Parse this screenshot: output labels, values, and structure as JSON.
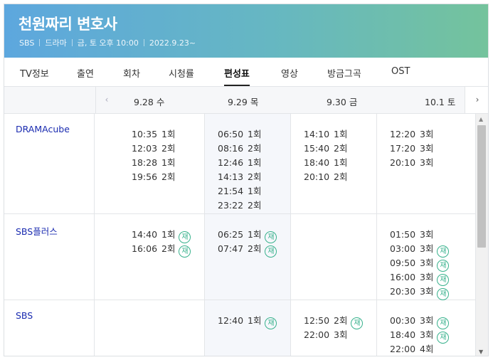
{
  "hero": {
    "title": "천원짜리 변호사",
    "network": "SBS",
    "genre": "드라마",
    "schedule": "금, 토 오후 10:00",
    "premiere": "2022.9.23~"
  },
  "tabs": [
    "TV정보",
    "출연",
    "회차",
    "시청률",
    "편성표",
    "영상",
    "방금그곡",
    "OST"
  ],
  "active_tab": "편성표",
  "datebar": {
    "prev_icon": "‹",
    "next_icon": "›",
    "dates": [
      {
        "date": "9.28",
        "day": "수"
      },
      {
        "date": "9.29",
        "day": "목"
      },
      {
        "date": "9.30",
        "day": "금"
      },
      {
        "date": "10.1",
        "day": "토"
      }
    ]
  },
  "rerun_mark": "재",
  "channels": [
    {
      "name": "DRAMAcube",
      "days": [
        [
          {
            "t": "10:35",
            "e": "1회"
          },
          {
            "t": "12:03",
            "e": "2회"
          },
          {
            "t": "18:28",
            "e": "1회"
          },
          {
            "t": "19:56",
            "e": "2회"
          }
        ],
        [
          {
            "t": "06:50",
            "e": "1회"
          },
          {
            "t": "08:16",
            "e": "2회"
          },
          {
            "t": "12:46",
            "e": "1회"
          },
          {
            "t": "14:13",
            "e": "2회"
          },
          {
            "t": "21:54",
            "e": "1회"
          },
          {
            "t": "23:22",
            "e": "2회"
          }
        ],
        [
          {
            "t": "14:10",
            "e": "1회"
          },
          {
            "t": "15:40",
            "e": "2회"
          },
          {
            "t": "18:40",
            "e": "1회"
          },
          {
            "t": "20:10",
            "e": "2회"
          }
        ],
        [
          {
            "t": "12:20",
            "e": "3회"
          },
          {
            "t": "17:20",
            "e": "3회"
          },
          {
            "t": "20:10",
            "e": "3회"
          }
        ]
      ]
    },
    {
      "name": "SBS플러스",
      "days": [
        [
          {
            "t": "14:40",
            "e": "1회",
            "r": true
          },
          {
            "t": "16:06",
            "e": "2회",
            "r": true
          }
        ],
        [
          {
            "t": "06:25",
            "e": "1회",
            "r": true
          },
          {
            "t": "07:47",
            "e": "2회",
            "r": true
          }
        ],
        [],
        [
          {
            "t": "01:50",
            "e": "3회"
          },
          {
            "t": "03:00",
            "e": "3회",
            "r": true
          },
          {
            "t": "09:50",
            "e": "3회",
            "r": true
          },
          {
            "t": "16:00",
            "e": "3회",
            "r": true
          },
          {
            "t": "20:30",
            "e": "3회",
            "r": true
          }
        ]
      ]
    },
    {
      "name": "SBS",
      "days": [
        [],
        [
          {
            "t": "12:40",
            "e": "1회",
            "r": true
          }
        ],
        [
          {
            "t": "12:50",
            "e": "2회",
            "r": true
          },
          {
            "t": "22:00",
            "e": "3회"
          }
        ],
        [
          {
            "t": "00:30",
            "e": "3회",
            "r": true
          },
          {
            "t": "18:40",
            "e": "3회",
            "r": true
          },
          {
            "t": "22:00",
            "e": "4회"
          }
        ]
      ]
    }
  ]
}
